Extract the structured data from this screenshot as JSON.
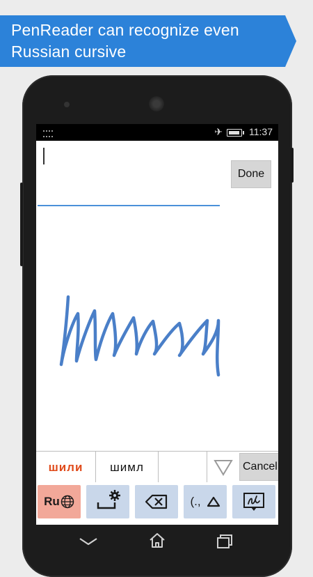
{
  "banner": {
    "text": "PenReader can recognize even Russian cursive",
    "color": "#2c82d9"
  },
  "statusbar": {
    "time": "11:37",
    "icons": [
      "keyboard-icon",
      "airplane-icon",
      "battery-icon"
    ]
  },
  "editor": {
    "done_label": "Done",
    "value": ""
  },
  "handwriting": {
    "ink_color": "#4a7fc8",
    "description_icon": "handwriting-ink"
  },
  "suggestions": {
    "items": [
      {
        "label": "шили",
        "color": "#e04a1a"
      },
      {
        "label": "шимл",
        "color": "#111111"
      },
      {
        "label": "",
        "color": "#111111"
      }
    ],
    "cancel_label": "Cancel"
  },
  "toolbar": {
    "language_label": "Ru",
    "punctuation_label": "(.,",
    "buttons": [
      "language-button",
      "settings-button",
      "backspace-button",
      "punctuation-button",
      "handwriting-mode-button"
    ],
    "active_color": "#f2a899",
    "button_color": "#c9d7ea"
  },
  "navbar": {
    "buttons": [
      "back-icon",
      "home-icon",
      "recent-apps-icon"
    ]
  }
}
